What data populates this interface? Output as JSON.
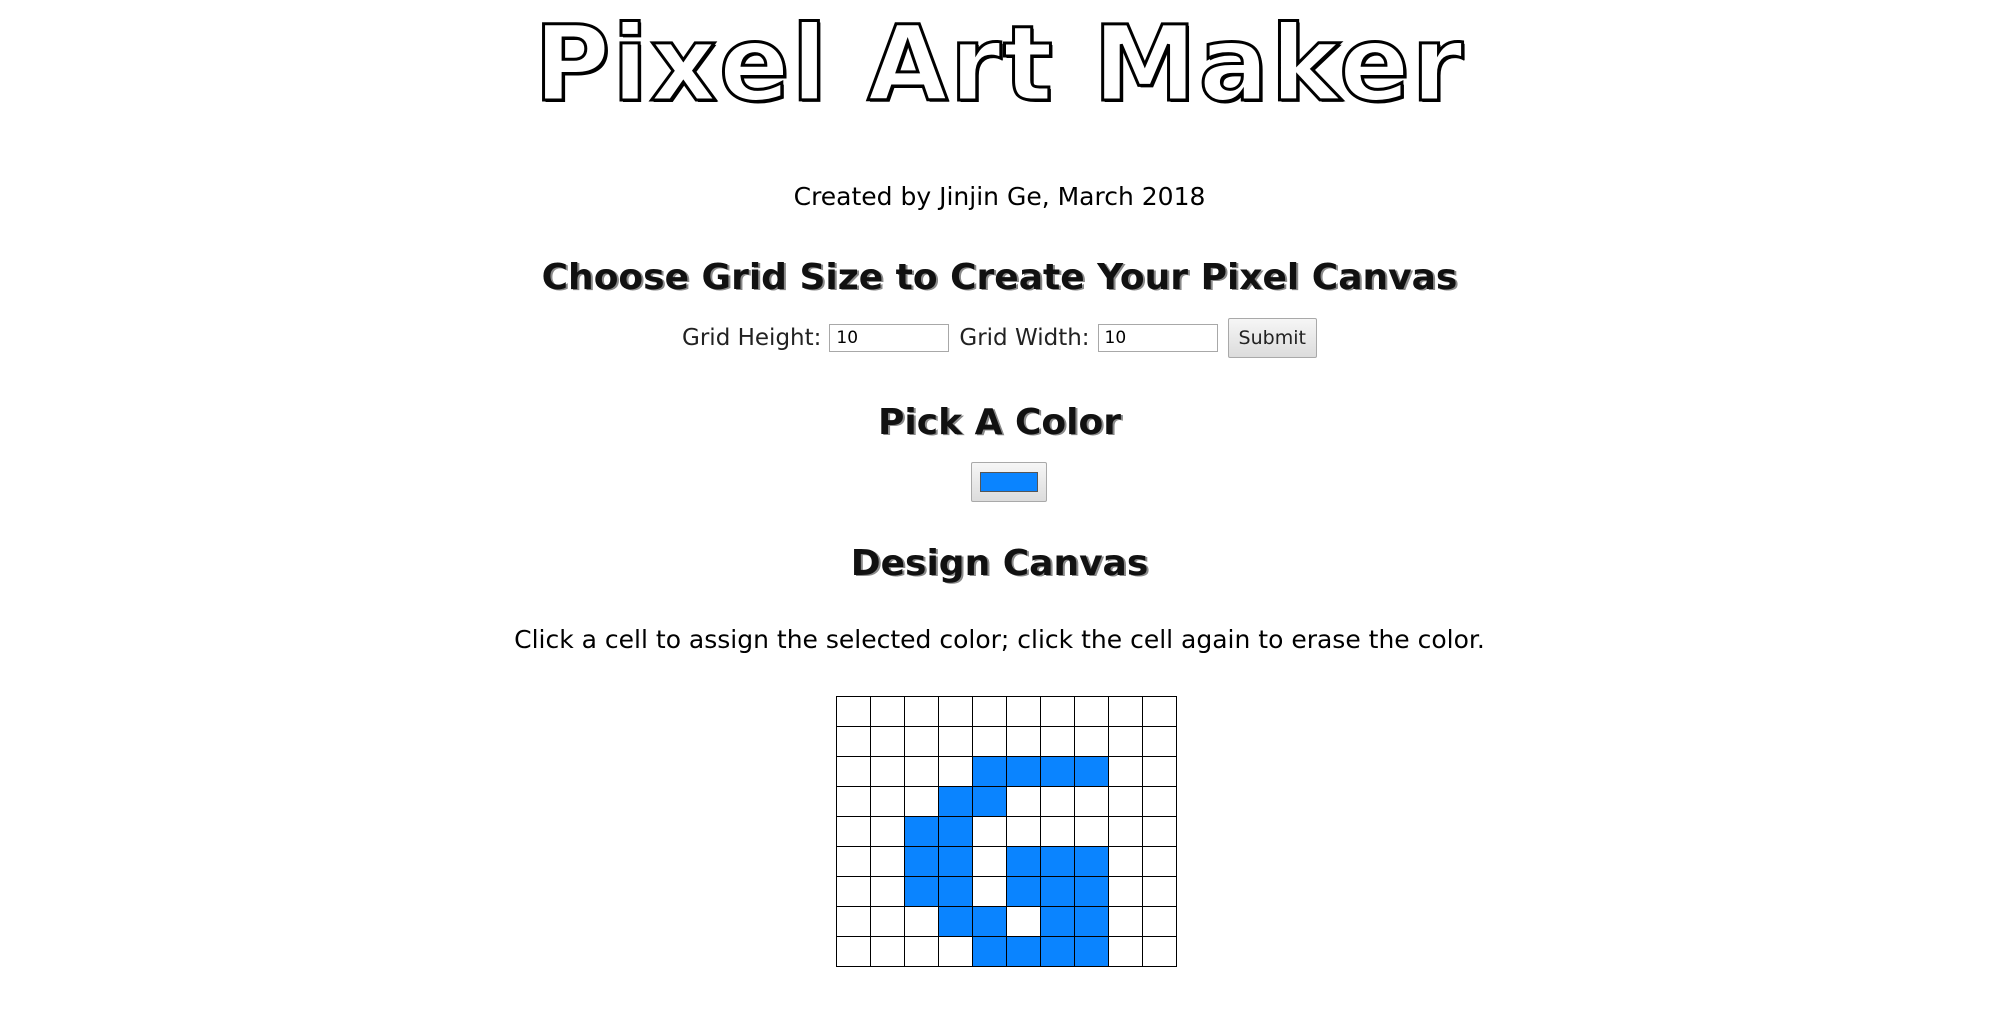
{
  "header": {
    "title": "Pixel Art Maker",
    "credit": "Created by Jinjin Ge, March 2018"
  },
  "grid_size": {
    "heading": "Choose Grid Size to Create Your Pixel Canvas",
    "height_label": "Grid Height:",
    "height_value": "10",
    "width_label": "Grid Width:",
    "width_value": "10",
    "submit_label": "Submit"
  },
  "color": {
    "heading": "Pick A Color",
    "selected": "#0a84ff"
  },
  "design": {
    "heading": "Design Canvas",
    "instructions": "Click a cell to assign the selected color; click the cell again to erase the color.",
    "rows": 9,
    "cols": 10,
    "filled_cells": [
      [
        2,
        4
      ],
      [
        2,
        5
      ],
      [
        2,
        6
      ],
      [
        2,
        7
      ],
      [
        3,
        3
      ],
      [
        3,
        4
      ],
      [
        4,
        2
      ],
      [
        4,
        3
      ],
      [
        5,
        2
      ],
      [
        5,
        3
      ],
      [
        5,
        5
      ],
      [
        5,
        6
      ],
      [
        5,
        7
      ],
      [
        6,
        2
      ],
      [
        6,
        3
      ],
      [
        6,
        5
      ],
      [
        6,
        6
      ],
      [
        6,
        7
      ],
      [
        7,
        3
      ],
      [
        7,
        4
      ],
      [
        7,
        6
      ],
      [
        7,
        7
      ],
      [
        8,
        4
      ],
      [
        8,
        5
      ],
      [
        8,
        6
      ],
      [
        8,
        7
      ]
    ]
  }
}
